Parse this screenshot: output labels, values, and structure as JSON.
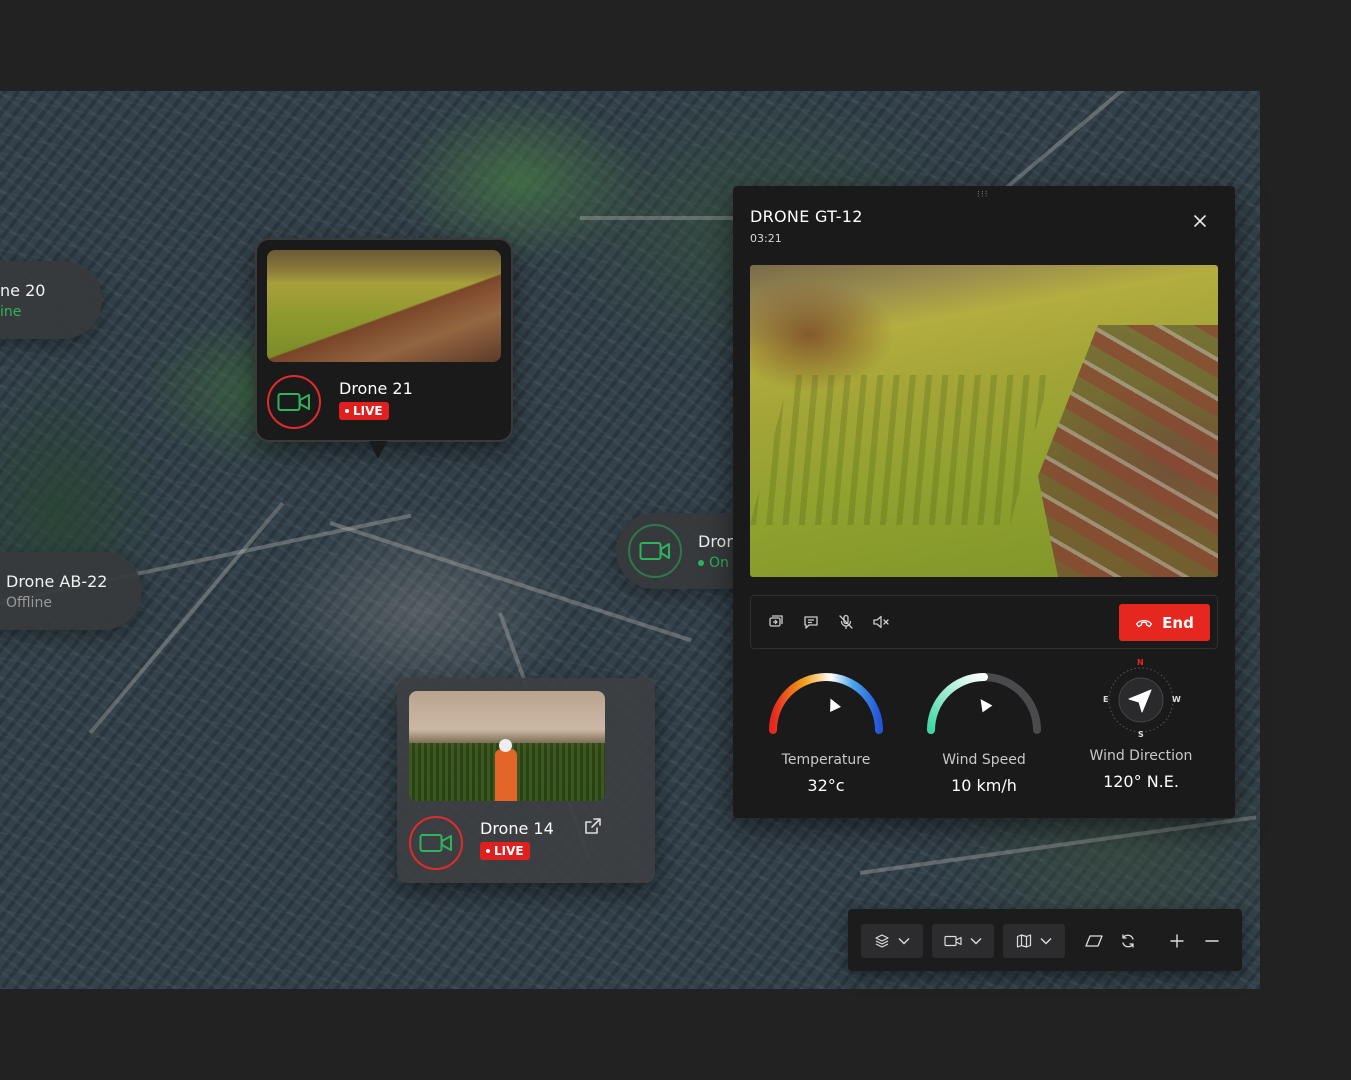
{
  "markers": {
    "drone20": {
      "name": "ne 20",
      "status": "ine"
    },
    "droneab22": {
      "name": "Drone AB-22",
      "status": "Offline"
    },
    "drone21": {
      "name": "Drone 21",
      "badge": "LIVE"
    },
    "drone14": {
      "name": "Drone 14",
      "badge": "LIVE"
    },
    "droneEdge": {
      "name": "Dror",
      "status": "On"
    }
  },
  "panel": {
    "title": "DRONE GT-12",
    "time": "03:21",
    "end_label": "End",
    "gauges": [
      {
        "label": "Temperature",
        "value": "32°c",
        "level": 0.78
      },
      {
        "label": "Wind Speed",
        "value": "10 km/h",
        "level": 0.45
      },
      {
        "label": "Wind Direction",
        "value": "120° N.E.",
        "compass": {
          "n": "N",
          "e": "E",
          "w": "W",
          "s": "S"
        }
      }
    ]
  },
  "colors": {
    "live": "#e01f1f",
    "end_button": "#e5271f",
    "online": "#2fb35a",
    "panel_bg": "#1a1a1b"
  },
  "icons": {
    "toolbar": [
      "layers-icon",
      "camera-icon",
      "map-icon",
      "shape-icon",
      "refresh-icon",
      "zoom-in-icon",
      "zoom-out-icon"
    ],
    "controls": [
      "switch-camera-icon",
      "chat-icon",
      "mic-off-icon",
      "speaker-mute-icon",
      "phone-end-icon"
    ]
  }
}
